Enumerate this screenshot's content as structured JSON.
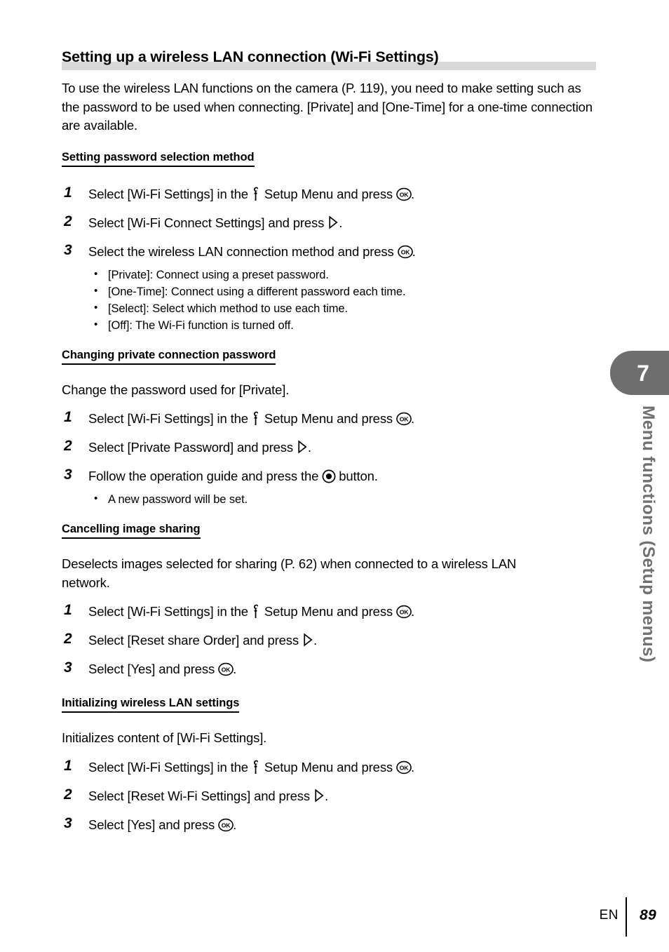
{
  "page": {
    "title": "Setting up a wireless LAN connection (Wi-Fi Settings)",
    "intro": "To use the wireless LAN functions on the camera (P. 119), you need to make setting such as the password to be used when connecting. [Private] and [One-Time] for a one-time connection are available.",
    "footer_language": "EN",
    "footer_page_number": "89",
    "tab_number": "7",
    "tab_label": "Menu functions (Setup menus)",
    "band_color": "#d9d9d9",
    "tab_color": "#6e6e6e",
    "tab_label_color": "#707070"
  },
  "sections": [
    {
      "heading": "Setting password selection method",
      "lead": "",
      "steps": [
        {
          "number": "1",
          "parts": [
            {
              "type": "text",
              "value": "Select [Wi-Fi Settings] in the "
            },
            {
              "type": "icon",
              "value": "wrench-setup-menu-icon"
            },
            {
              "type": "text",
              "value": " Setup Menu and press "
            },
            {
              "type": "icon",
              "value": "ok-button-icon"
            },
            {
              "type": "text",
              "value": "."
            }
          ],
          "text": "Select [Wi-Fi Settings] in the   Setup Menu and press  ."
        },
        {
          "number": "2",
          "parts": [
            {
              "type": "text",
              "value": "Select [Wi-Fi Connect Settings] and press "
            },
            {
              "type": "icon",
              "value": "right-triangle-icon"
            },
            {
              "type": "text",
              "value": "."
            }
          ],
          "text": "Select [Wi-Fi Connect Settings] and press  ."
        },
        {
          "number": "3",
          "parts": [
            {
              "type": "text",
              "value": "Select the wireless LAN connection method and press "
            },
            {
              "type": "icon",
              "value": "ok-button-icon"
            },
            {
              "type": "text",
              "value": "."
            }
          ],
          "text": "Select the wireless LAN connection method and press  ."
        }
      ],
      "bullets": [
        "[Private]: Connect using a preset password.",
        "[One-Time]: Connect using a different password each time.",
        "[Select]: Select which method to use each time.",
        "[Off]: The Wi-Fi function is turned off."
      ]
    },
    {
      "heading": "Changing private connection password",
      "lead": "Change the password used for [Private].",
      "steps": [
        {
          "number": "1",
          "text": "Select [Wi-Fi Settings] in the   Setup Menu and press  ."
        },
        {
          "number": "2",
          "text": "Select [Private Password] and press  ."
        },
        {
          "number": "3",
          "text": "Follow the operation guide and press the   button."
        }
      ],
      "bullets": [
        "A new password will be set."
      ]
    },
    {
      "heading": "Cancelling image sharing",
      "lead": "Deselects images selected for sharing (P. 62) when connected to a wireless LAN network.",
      "steps": [
        {
          "number": "1",
          "text": "Select [Wi-Fi Settings] in the   Setup Menu and press  ."
        },
        {
          "number": "2",
          "text": "Select [Reset share Order] and press  ."
        },
        {
          "number": "3",
          "text": "Select [Yes] and press  ."
        }
      ],
      "bullets": []
    },
    {
      "heading": "Initializing wireless LAN settings",
      "lead": "Initializes content of [Wi-Fi Settings].",
      "steps": [
        {
          "number": "1",
          "text": "Select [Wi-Fi Settings] in the   Setup Menu and press  ."
        },
        {
          "number": "2",
          "text": "Select [Reset Wi-Fi Settings] and press  ."
        },
        {
          "number": "3",
          "text": "Select [Yes] and press  ."
        }
      ],
      "bullets": []
    }
  ],
  "step_text": {
    "s1_a": "Select [Wi-Fi Settings] in the",
    "s1_b": "Setup Menu and press",
    "s1_c": ".",
    "sec1_step2_a": "Select [Wi-Fi Connect Settings] and press",
    "sec1_step2_b": ".",
    "sec1_step3_a": "Select the wireless LAN connection method and press",
    "sec1_step3_b": ".",
    "sec2_step2_a": "Select [Private Password] and press",
    "sec2_step2_b": ".",
    "sec2_step3_a": "Follow the operation guide and press the",
    "sec2_step3_b": "button.",
    "sec3_step2_a": "Select [Reset share Order] and press",
    "sec3_step2_b": ".",
    "sec3_step3_a": "Select [Yes] and press",
    "sec3_step3_b": ".",
    "sec4_step2_a": "Select [Reset Wi-Fi Settings] and press",
    "sec4_step2_b": ".",
    "sec4_step3_a": "Select [Yes] and press",
    "sec4_step3_b": "."
  }
}
